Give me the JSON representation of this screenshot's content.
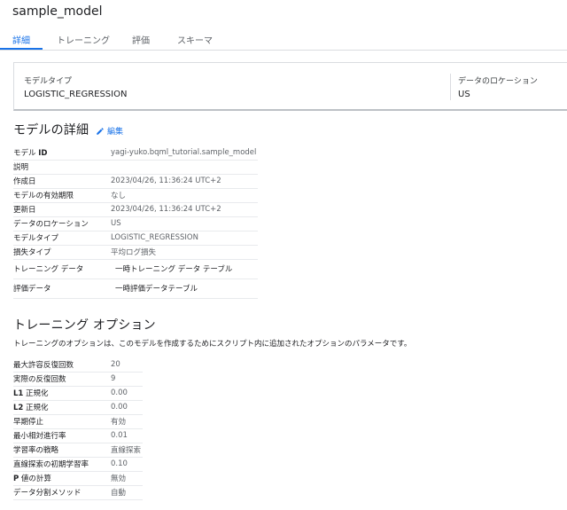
{
  "title": "sample_model",
  "tabs": [
    {
      "label": "詳細"
    },
    {
      "label": "トレーニング"
    },
    {
      "label": "評価"
    },
    {
      "label": "スキーマ"
    }
  ],
  "summary": {
    "model_type_label": "モデルタイプ",
    "model_type_value": "LOGISTIC_REGRESSION",
    "location_label": "データのロケーション",
    "location_value": "US"
  },
  "details": {
    "heading": "モデルの詳細",
    "edit_label": "編集",
    "rows": [
      {
        "key_prefix": "モデル ",
        "key_bold": "ID",
        "value": "yagi-yuko.bqml_tutorial.sample_model"
      },
      {
        "key_prefix": "説明",
        "key_bold": "",
        "value": ""
      },
      {
        "key_prefix": "作成日",
        "key_bold": "",
        "value": "2023/04/26, 11:36:24 UTC+2"
      },
      {
        "key_prefix": "モデルの有効期限",
        "key_bold": "",
        "value": "なし"
      },
      {
        "key_prefix": "更新日",
        "key_bold": "",
        "value": "2023/04/26, 11:36:24 UTC+2"
      },
      {
        "key_prefix": "データのロケーション",
        "key_bold": "",
        "value": "US"
      },
      {
        "key_prefix": "モデルタイプ",
        "key_bold": "",
        "value": "LOGISTIC_REGRESSION"
      },
      {
        "key_prefix": "損失タイプ",
        "key_bold": "",
        "value": "平均ログ損失"
      },
      {
        "key_prefix": "トレーニング データ",
        "key_bold": "",
        "value": "一時トレーニング データ テーブル"
      },
      {
        "key_prefix": "評価データ",
        "key_bold": "",
        "value": "一時評価データテーブル"
      }
    ]
  },
  "training": {
    "heading": "トレーニング オプション",
    "description": "トレーニングのオプションは、このモデルを作成するためにスクリプト内に追加されたオプションのパラメータです。",
    "rows": [
      {
        "key_bold": "",
        "key_suffix": "最大許容反復回数",
        "value": "20"
      },
      {
        "key_bold": "",
        "key_suffix": "実際の反復回数",
        "value": "9"
      },
      {
        "key_bold": "L1",
        "key_suffix": " 正規化",
        "value": "0.00"
      },
      {
        "key_bold": "L2",
        "key_suffix": " 正規化",
        "value": "0.00"
      },
      {
        "key_bold": "",
        "key_suffix": "早期停止",
        "value": "有効"
      },
      {
        "key_bold": "",
        "key_suffix": "最小相対進行率",
        "value": "0.01"
      },
      {
        "key_bold": "",
        "key_suffix": "学習率の戦略",
        "value": "直線探索"
      },
      {
        "key_bold": "",
        "key_suffix": "直線探索の初期学習率",
        "value": "0.10"
      },
      {
        "key_bold": "P",
        "key_suffix": " 値の計算",
        "value": "無効"
      },
      {
        "key_bold": "",
        "key_suffix": "データ分割メソッド",
        "value": "自動"
      }
    ]
  }
}
